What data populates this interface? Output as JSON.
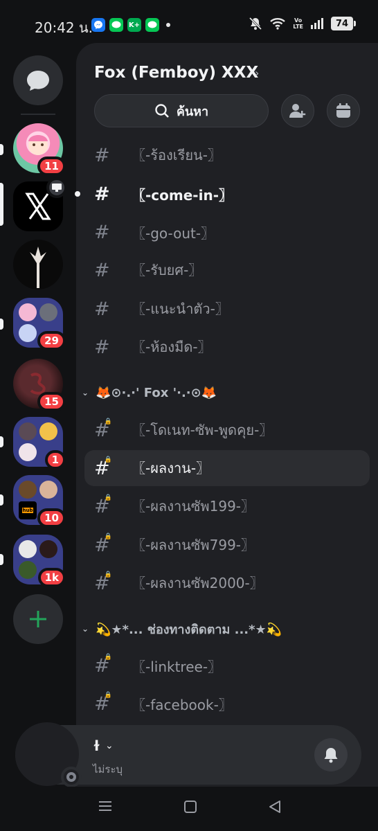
{
  "status_bar": {
    "time": "20:42 น.",
    "battery": "74",
    "notification_apps": [
      "messenger",
      "line",
      "kplus",
      "line"
    ],
    "kplus_label": "K+"
  },
  "rail": {
    "servers": [
      {
        "name": "dm",
        "badge": ""
      },
      {
        "name": "server-pink-avatar",
        "badge": "11"
      },
      {
        "name": "server-x",
        "badge": ""
      },
      {
        "name": "server-dark-figure",
        "badge": ""
      },
      {
        "name": "folder-1",
        "badge": "29"
      },
      {
        "name": "server-red",
        "badge": "15"
      },
      {
        "name": "folder-2",
        "badge": "1"
      },
      {
        "name": "folder-3",
        "badge": "10"
      },
      {
        "name": "folder-4",
        "badge": "1k"
      }
    ],
    "add_server": "+"
  },
  "header": {
    "server_name": "Fox (Femboy) XXX",
    "search_placeholder": "ค้นหา"
  },
  "channels_top": [
    {
      "name": "〖-ร้องเรียน-〗",
      "locked": false
    },
    {
      "name": "〖-come-in-〗",
      "locked": false,
      "unread": true
    },
    {
      "name": "〖-go-out-〗",
      "locked": false
    },
    {
      "name": "〖-รับยศ-〗",
      "locked": false
    },
    {
      "name": "〖-แนะนำตัว-〗",
      "locked": false
    },
    {
      "name": "〖-ห้องมืด-〗",
      "locked": false
    }
  ],
  "category_1": {
    "name": "🦊⊙·.·' Fox '·.·⊙🦊",
    "channels": [
      {
        "name": "〖-โดเนท-ซัพ-พูดคุย-〗",
        "locked": true
      },
      {
        "name": "〖-ผลงาน-〗",
        "locked": true,
        "active": true
      },
      {
        "name": "〖-ผลงานซัพ199-〗",
        "locked": true
      },
      {
        "name": "〖-ผลงานซัพ799-〗",
        "locked": true
      },
      {
        "name": "〖-ผลงานซัพ2000-〗",
        "locked": true
      }
    ]
  },
  "category_2": {
    "name": "💫★*... ช่องทางติดตาม ...*★💫",
    "channels": [
      {
        "name": "〖-linktree-〗",
        "locked": true
      },
      {
        "name": "〖-facebook-〗",
        "locked": true
      }
    ]
  },
  "user_bar": {
    "username": "ɫ",
    "status": "ไม่ระบุ"
  },
  "colors": {
    "background": "#111214",
    "panel": "#1f2024",
    "badge": "#f23f43",
    "folder": "#393f8a",
    "add_green": "#23a55a"
  }
}
